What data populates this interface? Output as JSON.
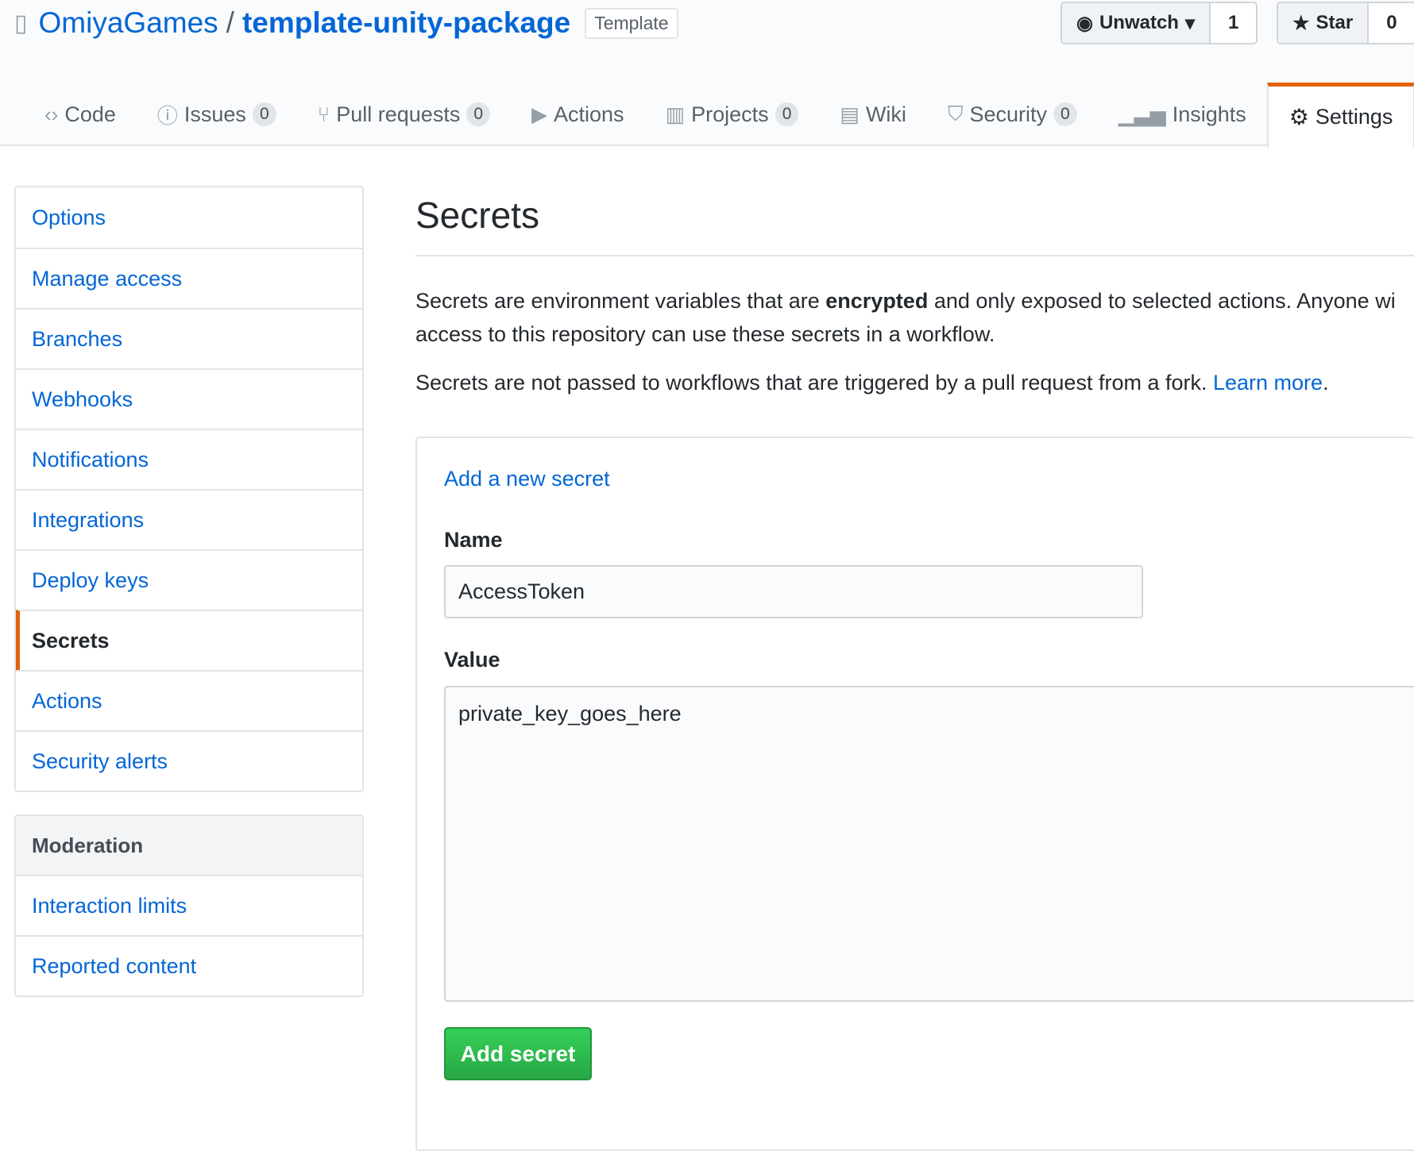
{
  "repo": {
    "owner": "OmiyaGames",
    "separator": "/",
    "name": "template-unity-package",
    "badge": "Template"
  },
  "actions": {
    "watch_label": "Unwatch",
    "watch_count": "1",
    "star_label": "Star",
    "star_count": "0"
  },
  "tabs": [
    {
      "label": "Code",
      "icon": "code-icon"
    },
    {
      "label": "Issues",
      "count": "0",
      "icon": "issue-icon"
    },
    {
      "label": "Pull requests",
      "count": "0",
      "icon": "pull-request-icon"
    },
    {
      "label": "Actions",
      "icon": "play-icon"
    },
    {
      "label": "Projects",
      "count": "0",
      "icon": "project-icon"
    },
    {
      "label": "Wiki",
      "icon": "book-icon"
    },
    {
      "label": "Security",
      "count": "0",
      "icon": "shield-icon"
    },
    {
      "label": "Insights",
      "icon": "graph-icon"
    },
    {
      "label": "Settings",
      "icon": "gear-icon",
      "selected": true
    }
  ],
  "sidebar": {
    "items": [
      "Options",
      "Manage access",
      "Branches",
      "Webhooks",
      "Notifications",
      "Integrations",
      "Deploy keys",
      "Secrets",
      "Actions",
      "Security alerts"
    ],
    "selected": "Secrets"
  },
  "moderation": {
    "title": "Moderation",
    "items": [
      "Interaction limits",
      "Reported content"
    ]
  },
  "main": {
    "title": "Secrets",
    "p1_a": "Secrets are environment variables that are ",
    "p1_bold": "encrypted",
    "p1_b": " and only exposed to selected actions. Anyone wi",
    "p1_c": "access to this repository can use these secrets in a workflow.",
    "p2": "Secrets are not passed to workflows that are triggered by a pull request from a fork. ",
    "p2_link": "Learn more",
    "p2_end": ".",
    "form": {
      "heading": "Add a new secret",
      "name_label": "Name",
      "name_value": "AccessToken",
      "value_label": "Value",
      "value_value": "private_key_goes_here",
      "submit": "Add secret"
    }
  },
  "colors": {
    "accent": "#e36209",
    "link": "#0366d6",
    "button": "#28a745"
  }
}
